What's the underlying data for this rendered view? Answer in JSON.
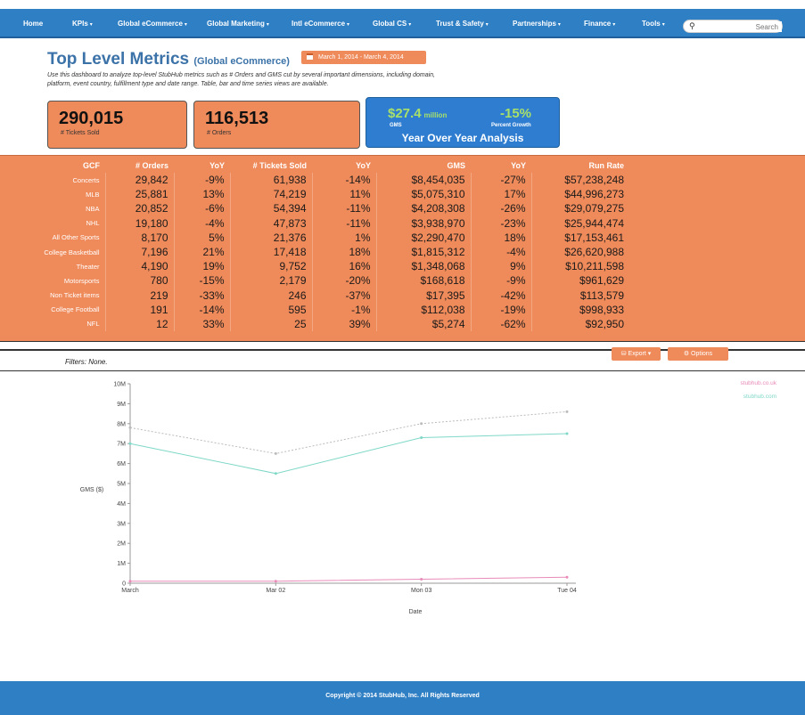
{
  "nav": {
    "items": [
      {
        "label": "Home",
        "caret": false
      },
      {
        "label": "KPIs",
        "caret": true
      },
      {
        "label": "Global eCommerce",
        "caret": true
      },
      {
        "label": "Global Marketing",
        "caret": true
      },
      {
        "label": "Intl eCommerce",
        "caret": true
      },
      {
        "label": "Global CS",
        "caret": true
      },
      {
        "label": "Trust & Safety",
        "caret": true
      },
      {
        "label": "Partnerships",
        "caret": true
      },
      {
        "label": "Finance",
        "caret": true
      },
      {
        "label": "Tools",
        "caret": true
      }
    ],
    "search_placeholder": "Search"
  },
  "header": {
    "title": "Top Level Metrics",
    "subtitle": "(Global eCommerce)",
    "date_range": "March 1, 2014 - March 4, 2014",
    "description": "Use this dashboard to analyze top-level StubHub metrics such as # Orders and GMS cut by several important dimensions, including domain, platform, event country, fulfillment type and date range. Table, bar and time series views are available."
  },
  "kpis": {
    "tickets_sold": {
      "value": "290,015",
      "label": "# Tickets Sold"
    },
    "orders": {
      "value": "116,513",
      "label": "# Orders"
    },
    "yoy": {
      "gms_value": "$27.4",
      "gms_unit": "million",
      "gms_label": "GMS",
      "growth_value": "-15%",
      "growth_label": "Percent Growth",
      "title": "Year Over Year Analysis"
    }
  },
  "table": {
    "headers": [
      "GCF",
      "# Orders",
      "YoY",
      "# Tickets Sold",
      "YoY",
      "GMS",
      "YoY",
      "Run Rate"
    ],
    "rows": [
      [
        "Concerts",
        "29,842",
        "-9%",
        "61,938",
        "-14%",
        "$8,454,035",
        "-27%",
        "$57,238,248"
      ],
      [
        "MLB",
        "25,881",
        "13%",
        "74,219",
        "11%",
        "$5,075,310",
        "17%",
        "$44,996,273"
      ],
      [
        "NBA",
        "20,852",
        "-6%",
        "54,394",
        "-11%",
        "$4,208,308",
        "-26%",
        "$29,079,275"
      ],
      [
        "NHL",
        "19,180",
        "-4%",
        "47,873",
        "-11%",
        "$3,938,970",
        "-23%",
        "$25,944,474"
      ],
      [
        "All Other Sports",
        "8,170",
        "5%",
        "21,376",
        "1%",
        "$2,290,470",
        "18%",
        "$17,153,461"
      ],
      [
        "College Basketball",
        "7,196",
        "21%",
        "17,418",
        "18%",
        "$1,815,312",
        "-4%",
        "$26,620,988"
      ],
      [
        "Theater",
        "4,190",
        "19%",
        "9,752",
        "16%",
        "$1,348,068",
        "9%",
        "$10,211,598"
      ],
      [
        "Motorsports",
        "780",
        "-15%",
        "2,179",
        "-20%",
        "$168,618",
        "-9%",
        "$961,629"
      ],
      [
        "Non Ticket items",
        "219",
        "-33%",
        "246",
        "-37%",
        "$17,395",
        "-42%",
        "$113,579"
      ],
      [
        "College Football",
        "191",
        "-14%",
        "595",
        "-1%",
        "$112,038",
        "-19%",
        "$998,933"
      ],
      [
        "NFL",
        "12",
        "33%",
        "25",
        "39%",
        "$5,274",
        "-62%",
        "$92,950"
      ]
    ]
  },
  "filters": {
    "text": "Filters: None.",
    "export_label": "Export",
    "options_label": "Options"
  },
  "chart_data": {
    "type": "line",
    "title": "",
    "xlabel": "Date",
    "ylabel": "GMS ($)",
    "x": [
      "March",
      "Mar 02",
      "Mon 03",
      "Tue 04"
    ],
    "yticks": [
      "0",
      "1M",
      "2M",
      "3M",
      "4M",
      "5M",
      "6M",
      "7M",
      "8M",
      "9M",
      "10M"
    ],
    "ylim": [
      0,
      10000000
    ],
    "grid": false,
    "legend_position": "top-right",
    "series": [
      {
        "name": "stubhub.co.uk",
        "color": "#e88bb8",
        "values": [
          100000,
          100000,
          200000,
          300000
        ]
      },
      {
        "name": "stubhub.com",
        "color": "#7fd8c8",
        "values": [
          7000000,
          5500000,
          7300000,
          7500000
        ]
      },
      {
        "name": "",
        "color": "#bbbbbb",
        "values": [
          7800000,
          6500000,
          8000000,
          8600000
        ]
      }
    ]
  },
  "footer": {
    "text": "Copyright © 2014 StubHub, Inc. All Rights Reserved"
  }
}
